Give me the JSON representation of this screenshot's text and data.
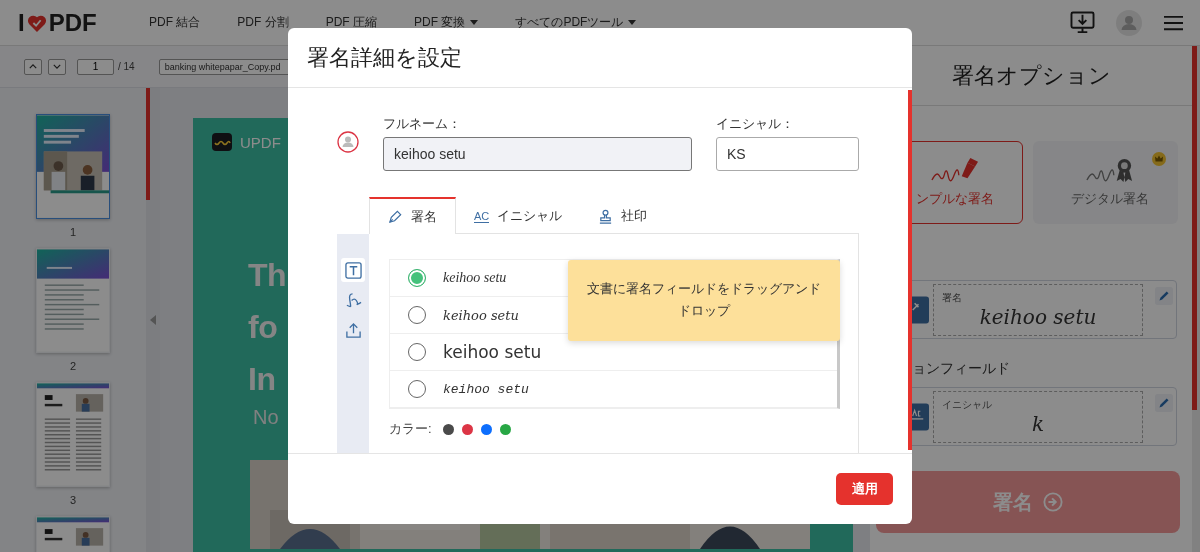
{
  "header": {
    "logo": {
      "before": "I",
      "after": "PDF"
    },
    "nav": [
      {
        "label": "PDF 結合",
        "dropdown": false
      },
      {
        "label": "PDF 分割",
        "dropdown": false
      },
      {
        "label": "PDF 圧縮",
        "dropdown": false
      },
      {
        "label": "PDF 変換",
        "dropdown": true
      },
      {
        "label": "すべてのPDFツール",
        "dropdown": true
      }
    ]
  },
  "toolbar": {
    "page": "1",
    "total": "/ 14",
    "file_name": "banking whitepapar_Copy.pd"
  },
  "thumbnails": [
    {
      "kind": "cover",
      "number": "1",
      "selected": true
    },
    {
      "kind": "contents",
      "number": "2",
      "selected": false
    },
    {
      "kind": "article",
      "number": "3",
      "selected": false
    },
    {
      "kind": "article",
      "selected": false
    }
  ],
  "document": {
    "logo": "UPDF",
    "title_lines": [
      "Th",
      "fo",
      "In"
    ],
    "subtitle": "No"
  },
  "sign_panel": {
    "title": "署名オプション",
    "types": [
      {
        "kind": "simple",
        "label": "ンプルな署名",
        "selected": true,
        "premium": false
      },
      {
        "kind": "digital",
        "label": "デジタル署名",
        "selected": false,
        "premium": true
      }
    ],
    "fields": [
      {
        "kind": "signature",
        "label": "署名",
        "value": "keihoo setu"
      },
      {
        "kind": "initials",
        "heading": "ョンフィールド",
        "label": "イニシャル",
        "value": "k"
      }
    ],
    "button": "署名"
  },
  "modal": {
    "title": "署名詳細を設定",
    "full_name": {
      "label": "フルネーム：",
      "value": "keihoo setu"
    },
    "initials": {
      "label": "イニシャル：",
      "value": "KS"
    },
    "tabs": [
      {
        "kind": "pen",
        "label": "署名",
        "selected": true
      },
      {
        "kind": "text",
        "icon_text": "AC",
        "label": "イニシャル",
        "selected": false
      },
      {
        "kind": "stamp",
        "label": "社印",
        "selected": false
      }
    ],
    "tools": [
      {
        "kind": "type",
        "selected": true
      },
      {
        "kind": "draw",
        "selected": false
      },
      {
        "kind": "upload",
        "selected": false
      }
    ],
    "styles": [
      {
        "text": "keihoo setu",
        "selected": true
      },
      {
        "text": "keihoo setu",
        "selected": false
      },
      {
        "text": "keihoo setu",
        "selected": false
      },
      {
        "text": "keihoo setu",
        "selected": false
      }
    ],
    "tooltip": "文書に署名フィールドをドラッグアンドドロップ",
    "color_label": "カラー:",
    "colors": [
      {
        "color": "#4a4a4a"
      },
      {
        "color": "#dc3545"
      },
      {
        "color": "#0d6efd"
      },
      {
        "color": "#28a745"
      }
    ],
    "apply": "適用"
  }
}
